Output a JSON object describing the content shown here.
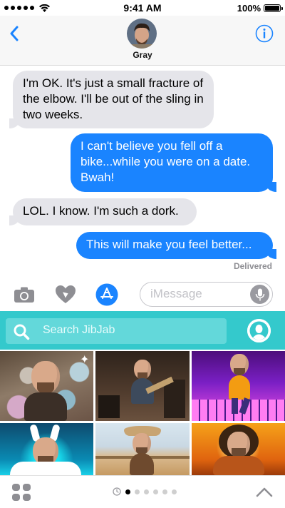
{
  "status_bar": {
    "time": "9:41 AM",
    "battery": "100%"
  },
  "header": {
    "contact_name": "Gray",
    "back_icon": "chevron-left-icon",
    "info_icon": "info-icon"
  },
  "messages": [
    {
      "direction": "incoming",
      "text": "I'm OK. It's just a small fracture of the elbow. I'll be out of the sling in two weeks."
    },
    {
      "direction": "outgoing",
      "text": "I can't believe you fell off a bike...while you were on a date. Bwah!"
    },
    {
      "direction": "incoming",
      "text": "LOL. I know. I'm such a dork."
    },
    {
      "direction": "outgoing",
      "text": "This will make you feel better..."
    }
  ],
  "delivery_status": "Delivered",
  "compose": {
    "placeholder": "iMessage",
    "camera_icon": "camera-icon",
    "heart_icon": "digital-touch-icon",
    "apps_icon": "app-store-icon",
    "mic_icon": "microphone-icon"
  },
  "jibjab": {
    "search_placeholder": "Search JibJab",
    "accent": "#34c9cc"
  },
  "bottom_bar": {
    "page_count": 6,
    "active_page": 1
  },
  "colors": {
    "outgoing": "#1a84ff",
    "incoming": "#e5e5ea",
    "tint": "#1a84ff"
  }
}
